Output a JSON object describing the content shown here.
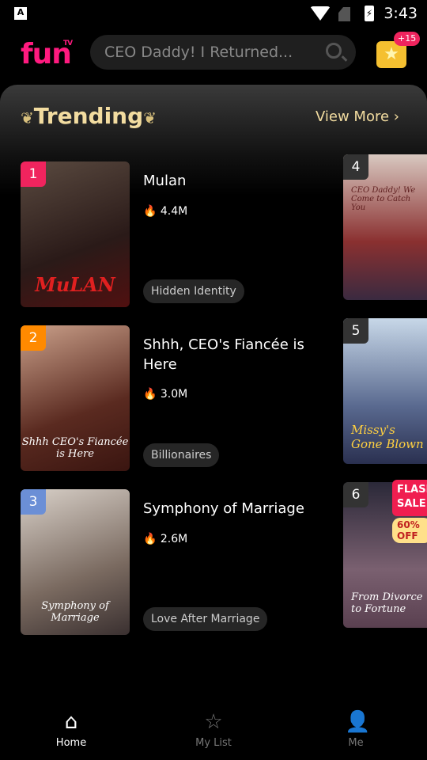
{
  "status": {
    "time": "3:43",
    "indicator": "A"
  },
  "header": {
    "logo": "fun",
    "logo_sup": "TV",
    "search_placeholder": "CEO Daddy! I Returned...",
    "reward_badge": "+15"
  },
  "section": {
    "title": "Trending",
    "view_more": "View More"
  },
  "items": [
    {
      "rank": "1",
      "title": "Mulan",
      "views": "4.4M",
      "tag": "Hidden Identity",
      "poster_text": "MuLAN",
      "rank_color": "#f0245e"
    },
    {
      "rank": "2",
      "title": "Shhh, CEO's Fiancée is Here",
      "views": "3.0M",
      "tag": "Billionaires",
      "poster_text": "Shhh CEO's Fiancée is Here",
      "rank_color": "#ff8a00"
    },
    {
      "rank": "3",
      "title": "Symphony of Marriage",
      "views": "2.6M",
      "tag": "Love After Marriage",
      "poster_text": "Symphony of Marriage",
      "rank_color": "#6b8fd6"
    }
  ],
  "side_items": [
    {
      "rank": "4",
      "poster_text": "CEO Daddy! We Come to Catch You"
    },
    {
      "rank": "5",
      "poster_text": "Missy's Gone Blown"
    },
    {
      "rank": "6",
      "poster_text": "From Divorce to Fortune"
    }
  ],
  "promo": {
    "label": "FLASH SALE",
    "discount": "60% OFF"
  },
  "nav": [
    {
      "label": "Home",
      "active": true
    },
    {
      "label": "My List"
    },
    {
      "label": "Me"
    }
  ]
}
